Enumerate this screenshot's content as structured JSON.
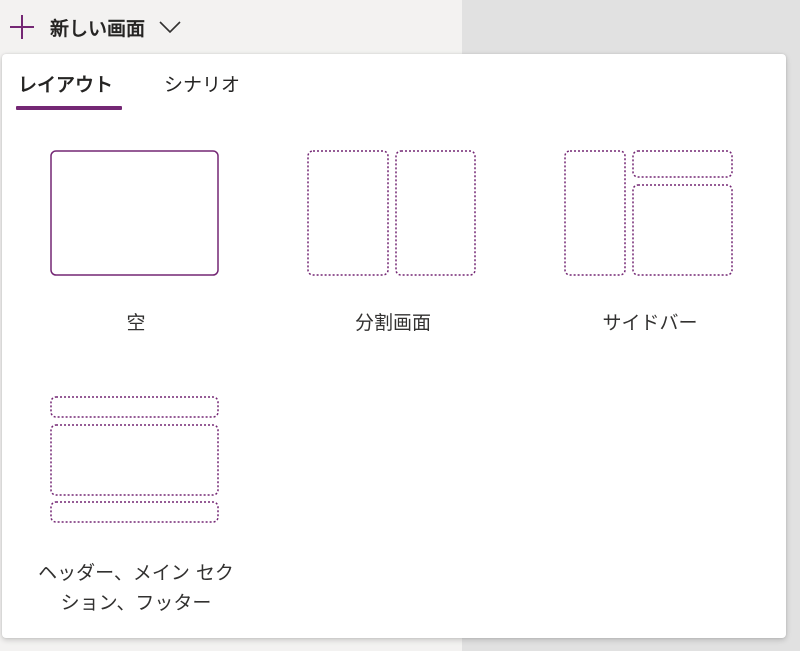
{
  "header": {
    "new_screen_label": "新しい画面",
    "icons": {
      "plus": "plus-icon",
      "expand": "chevron-down-icon"
    }
  },
  "tabs": [
    {
      "label": "レイアウト",
      "selected": true
    },
    {
      "label": "シナリオ",
      "selected": false
    }
  ],
  "layouts": [
    {
      "label": "空",
      "icon": "blank-layout-icon"
    },
    {
      "label": "分割画面",
      "icon": "split-screen-layout-icon"
    },
    {
      "label": "サイドバー",
      "icon": "sidebar-layout-icon"
    },
    {
      "label_line1": "ヘッダー、メイン セク",
      "label_line2": "ション、フッター",
      "icon": "header-main-footer-layout-icon"
    }
  ],
  "colors": {
    "accent": "#742774",
    "panel_background": "#ffffff",
    "left_background": "#f3f2f1",
    "right_background": "#e1e1e1"
  }
}
